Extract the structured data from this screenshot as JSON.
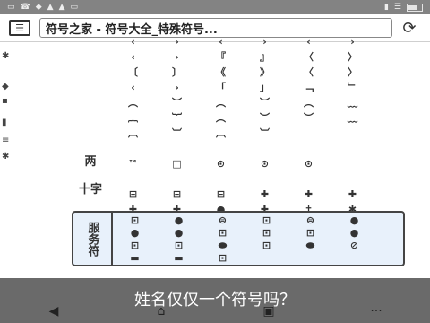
{
  "status_bar": {
    "left_glyphs": [
      "▭",
      "☎",
      "◆",
      "▲",
      "▲",
      "▭"
    ],
    "right_glyphs": [
      "▮",
      "☰",
      "▮"
    ]
  },
  "title_bar": {
    "menu_icon_glyph": "☰",
    "page_title": "符号之家 - 符号大全_特殊符号...",
    "reload_icon_glyph": "⟳"
  },
  "left_rail": [
    "✱",
    "◆",
    "▪",
    "▮",
    "≡",
    "✱"
  ],
  "table": {
    "row_labels": [
      {
        "text": "两",
        "row": 8
      },
      {
        "text": "十字",
        "row": 10
      }
    ],
    "rows": [
      [
        "‹",
        "›",
        "‹",
        "›",
        "‹",
        "›"
      ],
      [
        "‹",
        "›",
        "『",
        "』",
        "〈",
        "〉"
      ],
      [
        "〔",
        "〕",
        "《",
        "》",
        "〈",
        "〉"
      ],
      [
        "‹",
        "›",
        "「",
        "」",
        "﹁",
        "﹂"
      ],
      [
        "︵",
        "︶",
        "︵",
        "︶",
        "︵",
        "﹏"
      ],
      [
        "︷",
        "︸",
        "︵",
        "︶",
        "︶",
        "﹏"
      ],
      [
        "︹",
        "︺",
        "︹",
        "︺",
        "",
        ""
      ],
      [
        "",
        "",
        "",
        "",
        "",
        ""
      ],
      [
        "™",
        "□",
        "⊙",
        "⊙",
        "⊙",
        ""
      ],
      [
        "",
        "",
        "",
        "",
        "",
        ""
      ],
      [
        "⊟",
        "⊟",
        "⊟",
        "✚",
        "✚",
        "✚"
      ],
      [
        "✚",
        "✚",
        "●",
        "✚",
        "✝",
        "✱"
      ]
    ],
    "highlight_label": "服务符",
    "highlight_rows": [
      [
        "⊡",
        "●",
        "⊜",
        "⊡",
        "⊜",
        "●"
      ],
      [
        "●",
        "●",
        "⊡",
        "⊡",
        "⊡",
        "●"
      ],
      [
        "⊡",
        "⊡",
        "⬬",
        "⊡",
        "⬬",
        "⊘"
      ],
      [
        "▬",
        "▬",
        "⊡",
        "",
        "",
        ""
      ]
    ]
  },
  "caption": "姓名仅仅一个符号吗？",
  "nav": {
    "back": "◀",
    "home": "⌂",
    "tabs": "▣",
    "more": "···"
  }
}
